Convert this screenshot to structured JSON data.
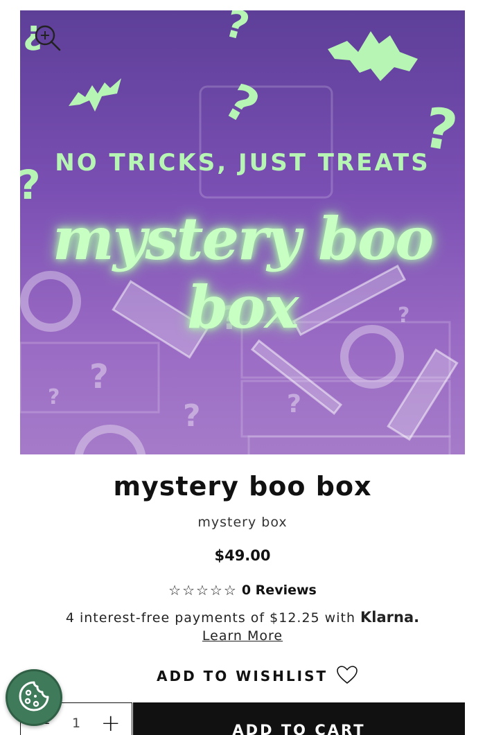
{
  "hero": {
    "tagline": "NO TRICKS, JUST TREATS",
    "script_title": "mystery boo box",
    "accent_color": "#b6f5b4",
    "background_color": "#7a4fb3"
  },
  "product": {
    "title": "mystery boo box",
    "type": "mystery box",
    "price": "$49.00"
  },
  "rating": {
    "stars": "☆☆☆☆☆",
    "reviews_label": "0 Reviews"
  },
  "klarna": {
    "text": "4 interest-free payments of $12.25 with",
    "brand": "Klarna.",
    "learn_more": "Learn More"
  },
  "wishlist": {
    "label": "ADD TO WISHLIST",
    "icon": "heart-outline-icon"
  },
  "cart": {
    "quantity": "1",
    "minus": "−",
    "plus": "+",
    "add_label": "ADD TO CART"
  },
  "icons": {
    "zoom": "zoom-in-icon",
    "cookie": "cookie-icon"
  }
}
